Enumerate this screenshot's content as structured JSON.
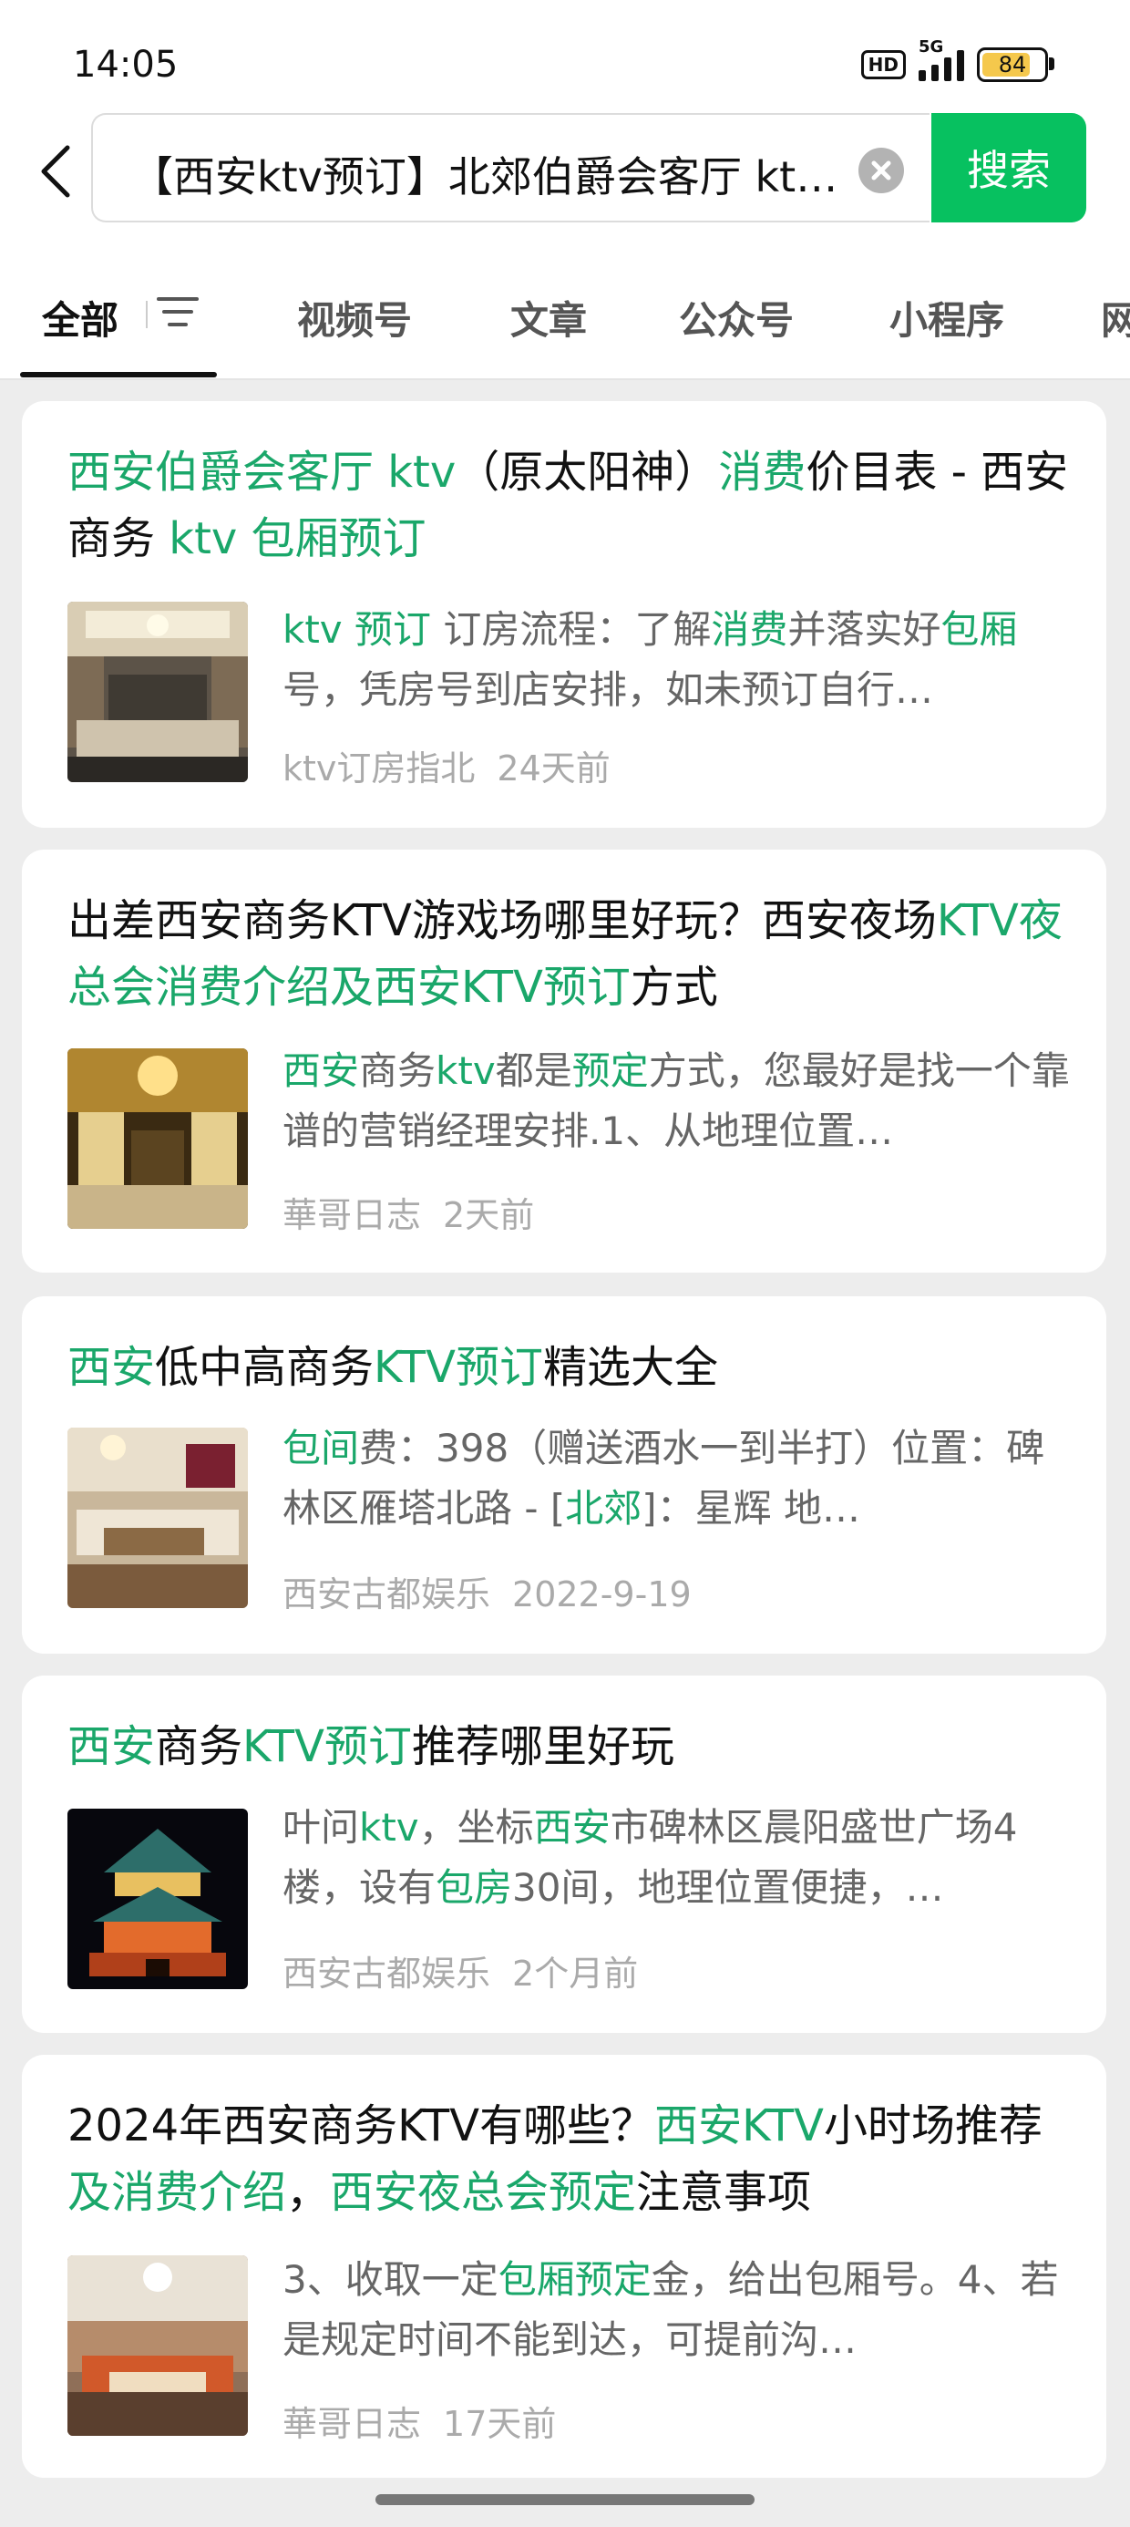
{
  "status_bar": {
    "time": "14:05",
    "hd": "HD",
    "network": "5G",
    "battery": "84"
  },
  "search": {
    "value": "【西安ktv预订】北郊伯爵会客厅 ktv（原太阳神）消费价目表",
    "button": "搜索"
  },
  "tabs": [
    "全部",
    "视频号",
    "文章",
    "公众号",
    "小程序",
    "网页"
  ],
  "results": [
    {
      "title": [
        {
          "t": "西安伯爵会客厅 ktv",
          "hl": true
        },
        {
          "t": "（原太阳神）",
          "hl": false
        },
        {
          "t": "消费",
          "hl": true
        },
        {
          "t": "价目表 - 西安商务 ",
          "hl": false
        },
        {
          "t": "ktv 包厢预订",
          "hl": true
        }
      ],
      "snippet": [
        {
          "t": "ktv 预订",
          "hl": true
        },
        {
          "t": " 订房流程：了解",
          "hl": false
        },
        {
          "t": "消费",
          "hl": true
        },
        {
          "t": "并落实好",
          "hl": false
        },
        {
          "t": "包厢",
          "hl": true
        },
        {
          "t": "号，凭房号到店安排，如未预订自行…",
          "hl": false
        }
      ],
      "source": "ktv订房指北",
      "time": "24天前",
      "thumb": "room-a"
    },
    {
      "title": [
        {
          "t": "出差西安商务KTV游戏场哪里好玩？西安夜场",
          "hl": false
        },
        {
          "t": "KTV夜总会消费介绍及西安KTV预订",
          "hl": true
        },
        {
          "t": "方式",
          "hl": false
        }
      ],
      "snippet": [
        {
          "t": "西安",
          "hl": true
        },
        {
          "t": "商务",
          "hl": false
        },
        {
          "t": "ktv",
          "hl": true
        },
        {
          "t": "都是",
          "hl": false
        },
        {
          "t": "预定",
          "hl": true
        },
        {
          "t": "方式，您最好是找一个靠谱的营销经理安排.1、从地理位置…",
          "hl": false
        }
      ],
      "source": "華哥日志",
      "time": "2天前",
      "thumb": "room-b"
    },
    {
      "title": [
        {
          "t": "西安",
          "hl": true
        },
        {
          "t": "低中高商务",
          "hl": false
        },
        {
          "t": "KTV预订",
          "hl": true
        },
        {
          "t": "精选大全",
          "hl": false
        }
      ],
      "snippet": [
        {
          "t": "包间",
          "hl": true
        },
        {
          "t": "费：398（赠送酒水一到半打）位置：碑林区雁塔北路 - [",
          "hl": false
        },
        {
          "t": "北郊",
          "hl": true
        },
        {
          "t": "]：星辉 地…",
          "hl": false
        }
      ],
      "source": "西安古都娱乐",
      "time": "2022-9-19",
      "thumb": "room-c"
    },
    {
      "title": [
        {
          "t": "西安",
          "hl": true
        },
        {
          "t": "商务",
          "hl": false
        },
        {
          "t": "KTV预订",
          "hl": true
        },
        {
          "t": "推荐哪里好玩",
          "hl": false
        }
      ],
      "snippet": [
        {
          "t": "叶问",
          "hl": false
        },
        {
          "t": "ktv",
          "hl": true
        },
        {
          "t": "，坐标",
          "hl": false
        },
        {
          "t": "西安",
          "hl": true
        },
        {
          "t": "市碑林区晨阳盛世广场4楼，设有",
          "hl": false
        },
        {
          "t": "包房",
          "hl": true
        },
        {
          "t": "30间，地理位置便捷，…",
          "hl": false
        }
      ],
      "source": "西安古都娱乐",
      "time": "2个月前",
      "thumb": "tower"
    },
    {
      "title": [
        {
          "t": "2024年西安商务KTV有哪些？",
          "hl": false
        },
        {
          "t": "西安KTV",
          "hl": true
        },
        {
          "t": "小时场推荐",
          "hl": false
        },
        {
          "t": "及消费介绍",
          "hl": true
        },
        {
          "t": "，",
          "hl": false
        },
        {
          "t": "西安夜总会预定",
          "hl": true
        },
        {
          "t": "注意事项",
          "hl": false
        }
      ],
      "snippet": [
        {
          "t": "3、收取一定",
          "hl": false
        },
        {
          "t": "包厢预定",
          "hl": true
        },
        {
          "t": "金，给出包厢号。4、若是规定时间不能到达，可提前沟…",
          "hl": false
        }
      ],
      "source": "華哥日志",
      "time": "17天前",
      "thumb": "room-d"
    }
  ],
  "colors": {
    "accent": "#07c160",
    "highlight": "#1aa76a",
    "background": "#ededed"
  }
}
